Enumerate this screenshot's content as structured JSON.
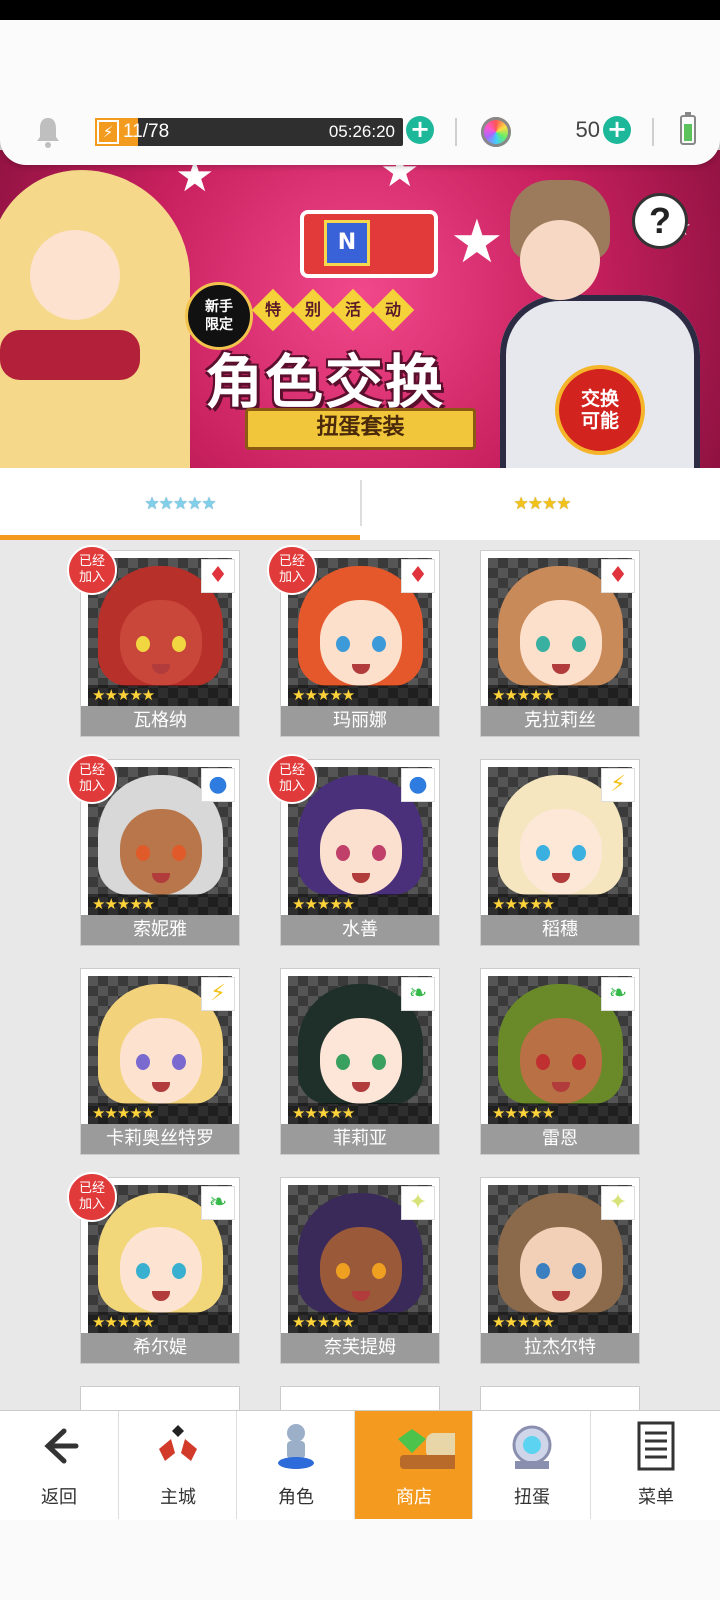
{
  "topbar": {
    "stamina": "11/78",
    "stamina_fraction": 0.14,
    "timer": "05:26:20",
    "gem_count": "50"
  },
  "banner": {
    "badge_new": "新手限定",
    "special_chars": [
      "特",
      "别",
      "活",
      "动"
    ],
    "title": "角色交换",
    "ribbon": "扭蛋套装",
    "exchange_badge": "交换可能",
    "help": "?",
    "chest_letter": "N"
  },
  "tabs": [
    {
      "label": "★★★★★",
      "active": true
    },
    {
      "label": "★★★★",
      "active": false
    }
  ],
  "characters": [
    {
      "name": "瓦格纳",
      "stars": "★★★★★",
      "element": "fire",
      "element_icon": "♦",
      "element_color": "#e0333c",
      "joined": true
    },
    {
      "name": "玛丽娜",
      "stars": "★★★★★",
      "element": "fire",
      "element_icon": "♦",
      "element_color": "#e0333c",
      "joined": true
    },
    {
      "name": "克拉莉丝",
      "stars": "★★★★★",
      "element": "fire",
      "element_icon": "♦",
      "element_color": "#e0333c",
      "joined": false
    },
    {
      "name": "索妮雅",
      "stars": "★★★★★",
      "element": "water",
      "element_icon": "●",
      "element_color": "#2f7ce0",
      "joined": true
    },
    {
      "name": "水善",
      "stars": "★★★★★",
      "element": "water",
      "element_icon": "●",
      "element_color": "#2f7ce0",
      "joined": true
    },
    {
      "name": "稻穗",
      "stars": "★★★★★",
      "element": "thunder",
      "element_icon": "⚡",
      "element_color": "#f2c21a",
      "joined": false
    },
    {
      "name": "卡莉奥丝特罗",
      "stars": "★★★★★",
      "element": "thunder",
      "element_icon": "⚡",
      "element_color": "#f2c21a",
      "joined": false
    },
    {
      "name": "菲莉亚",
      "stars": "★★★★★",
      "element": "wind",
      "element_icon": "❧",
      "element_color": "#36b84a",
      "joined": false
    },
    {
      "name": "雷恩",
      "stars": "★★★★★",
      "element": "wind",
      "element_icon": "❧",
      "element_color": "#36b84a",
      "joined": false
    },
    {
      "name": "希尔媞",
      "stars": "★★★★★",
      "element": "wind",
      "element_icon": "❧",
      "element_color": "#36b84a",
      "joined": true
    },
    {
      "name": "奈芙提姆",
      "stars": "★★★★★",
      "element": "light",
      "element_icon": "✦",
      "element_color": "#d8e27a",
      "joined": false
    },
    {
      "name": "拉杰尔特",
      "stars": "★★★★★",
      "element": "light",
      "element_icon": "✦",
      "element_color": "#d8e27a",
      "joined": false
    }
  ],
  "joined_label": "已经加入",
  "nav": [
    {
      "label": "返回",
      "icon": "back-arrow-icon"
    },
    {
      "label": "主城",
      "icon": "city-icon"
    },
    {
      "label": "角色",
      "icon": "character-icon"
    },
    {
      "label": "商店",
      "icon": "shop-icon",
      "active": true
    },
    {
      "label": "扭蛋",
      "icon": "gacha-icon"
    },
    {
      "label": "菜单",
      "icon": "menu-icon"
    }
  ]
}
